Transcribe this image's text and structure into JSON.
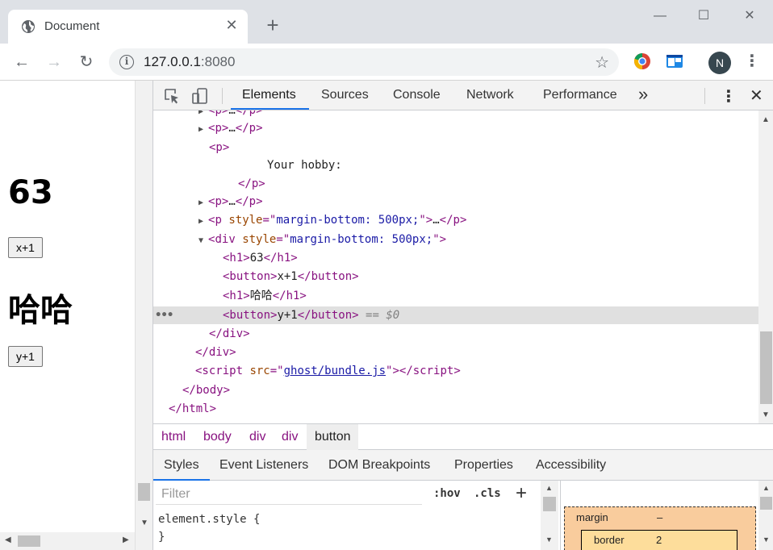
{
  "tab": {
    "title": "Document",
    "close": "✕"
  },
  "newtab": "+",
  "window": {
    "minimize": "—",
    "maximize": "☐",
    "close": "✕"
  },
  "toolbar": {
    "back": "←",
    "forward": "→",
    "reload": "↻",
    "url_host": "127.0.0.1",
    "url_port": ":8080",
    "star": "☆",
    "avatar": "N",
    "menu": "⋮"
  },
  "page": {
    "h1_first": "63",
    "button_first": "x+1",
    "h1_second": "哈哈",
    "button_second": "y+1"
  },
  "devtools": {
    "tabs": [
      "Elements",
      "Sources",
      "Console",
      "Network",
      "Performance"
    ],
    "more": "»",
    "menu": "⋮",
    "close": "✕",
    "breadcrumbs": [
      "html",
      "body",
      "div",
      "div",
      "button"
    ],
    "subtabs": [
      "Styles",
      "Event Listeners",
      "DOM Breakpoints",
      "Properties",
      "Accessibility"
    ],
    "filter_placeholder": "Filter",
    "hov": ":hov",
    "cls": ".cls",
    "add": "+",
    "element_style_open": "element.style {",
    "element_style_close": "}",
    "box_margin": "margin",
    "box_margin_value": "–",
    "box_border": "border",
    "box_border_value": "2",
    "selected_marker": "== $0",
    "dom": {
      "hobby_text": "Your hobby:",
      "style_value": "margin-bottom: 500px;",
      "h1_text": "63",
      "btn_x": "x+1",
      "h1_haha": "哈哈",
      "btn_y": "y+1",
      "script_src": "ghost/bundle.js"
    }
  }
}
